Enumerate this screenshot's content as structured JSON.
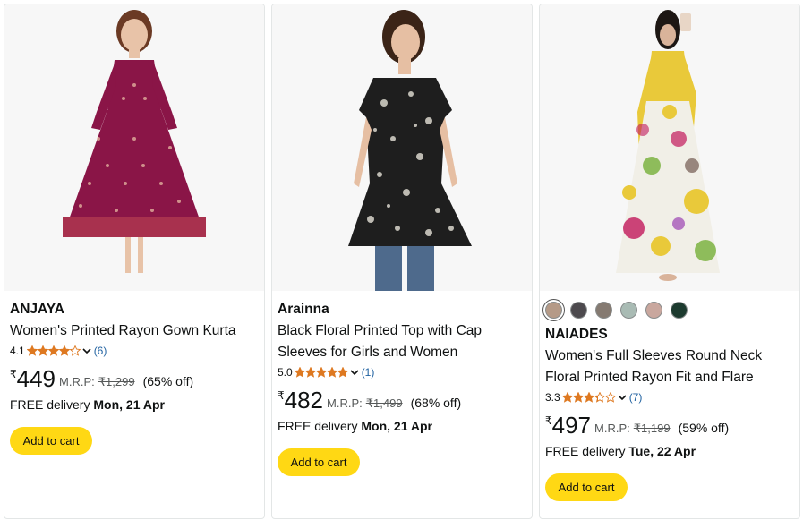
{
  "products": [
    {
      "brand": "ANJAYA",
      "title": "Women's Printed Rayon Gown Kurta",
      "rating": "4.1",
      "stars": 4.1,
      "review_count": "(6)",
      "currency": "₹",
      "price": "449",
      "mrp_label": "M.R.P:",
      "mrp": "₹1,299",
      "discount": "(65% off)",
      "delivery_prefix": "FREE delivery ",
      "delivery_date": "Mon, 21 Apr",
      "cart_label": "Add to cart",
      "image_alt": "woman-in-maroon-gown-kurta"
    },
    {
      "brand": "Arainna",
      "title": "Black Floral Printed Top with Cap Sleeves for Girls and Women",
      "rating": "5.0",
      "stars": 5,
      "review_count": "(1)",
      "currency": "₹",
      "price": "482",
      "mrp_label": "M.R.P:",
      "mrp": "₹1,499",
      "discount": "(68% off)",
      "delivery_prefix": "FREE delivery ",
      "delivery_date": "Mon, 21 Apr",
      "cart_label": "Add to cart",
      "image_alt": "woman-in-black-floral-top"
    },
    {
      "brand": "NAIADES",
      "title": "Women's Full Sleeves Round Neck Floral Printed Rayon Fit and Flare",
      "rating": "3.3",
      "stars": 3.3,
      "review_count": "(7)",
      "currency": "₹",
      "price": "497",
      "mrp_label": "M.R.P:",
      "mrp": "₹1,199",
      "discount": "(59% off)",
      "delivery_prefix": "FREE delivery ",
      "delivery_date": "Tue, 22 Apr",
      "cart_label": "Add to cart",
      "image_alt": "woman-in-yellow-floral-maxi-dress",
      "swatches": [
        "#b59a87",
        "#4d4a4e",
        "#857a71",
        "#a9bbb4",
        "#c9a79e",
        "#1d3b2f"
      ]
    }
  ],
  "colors": {
    "star": "#de7921",
    "link": "#2162a1",
    "cart_button": "#ffd814"
  }
}
